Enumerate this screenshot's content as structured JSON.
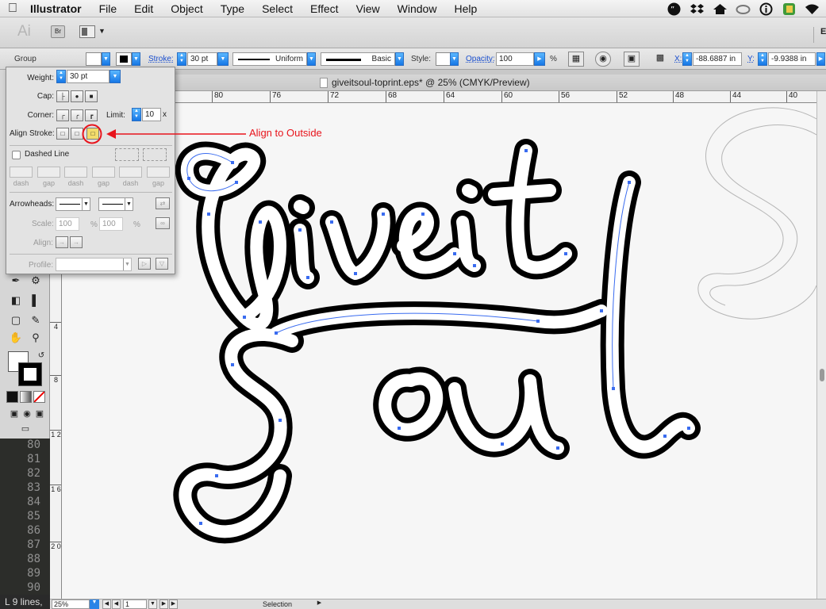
{
  "menubar": {
    "app_name": "Illustrator",
    "items": [
      "File",
      "Edit",
      "Object",
      "Type",
      "Select",
      "Effect",
      "View",
      "Window",
      "Help"
    ],
    "status_icons": [
      "hangouts-icon",
      "dropbox-icon",
      "home-icon",
      "creative-cloud-icon",
      "info-icon",
      "evernote-icon",
      "wifi-icon"
    ]
  },
  "appbar": {
    "logo": "Ai",
    "bridge": "Br",
    "workspace": "ES"
  },
  "controlbar": {
    "selection_type": "Group",
    "stroke_label": "Stroke:",
    "stroke_weight": "30 pt",
    "stroke_profile": "Uniform",
    "brush": "Basic",
    "style_label": "Style:",
    "opacity_label": "Opacity:",
    "opacity_value": "100",
    "opacity_unit": "%",
    "x_label": "X:",
    "x_value": "-88.6887 in",
    "y_label": "Y:",
    "y_value": "-9.9388 in"
  },
  "document": {
    "title": "giveitsoul-toprint.eps* @ 25% (CMYK/Preview)"
  },
  "ruler": {
    "h_ticks": [
      "80",
      "76",
      "72",
      "68",
      "64",
      "60",
      "56",
      "52",
      "48",
      "44",
      "40"
    ],
    "v_ticks": [
      "4",
      "8",
      "1 2",
      "1 6",
      "2 0"
    ]
  },
  "stroke_panel": {
    "weight_label": "Weight:",
    "weight_value": "30 pt",
    "cap_label": "Cap:",
    "corner_label": "Corner:",
    "limit_label": "Limit:",
    "limit_value": "10",
    "limit_unit": "x",
    "align_label": "Align Stroke:",
    "dashed_label": "Dashed Line",
    "dash_labels": [
      "dash",
      "gap",
      "dash",
      "gap",
      "dash",
      "gap"
    ],
    "arrowheads_label": "Arrowheads:",
    "scale_label": "Scale:",
    "scale_1": "100",
    "scale_2": "100",
    "scale_unit": "%",
    "align_arrow_label": "Align:",
    "profile_label": "Profile:"
  },
  "annotation": {
    "text": "Align to Outside",
    "color": "#e8141c"
  },
  "code_gutter": {
    "line_numbers": [
      "80",
      "81",
      "82",
      "83",
      "84",
      "85",
      "86",
      "87",
      "88",
      "89",
      "90"
    ],
    "status": "L 9 lines,"
  },
  "bottombar": {
    "zoom": "25%",
    "page": "1",
    "tool_status": "Selection"
  },
  "artwork": {
    "text_line1": "Give it",
    "text_line2": "Soul",
    "stroke_color": "#000000",
    "fill_color": "#ffffff",
    "anchor_color": "#3a6cf0"
  }
}
